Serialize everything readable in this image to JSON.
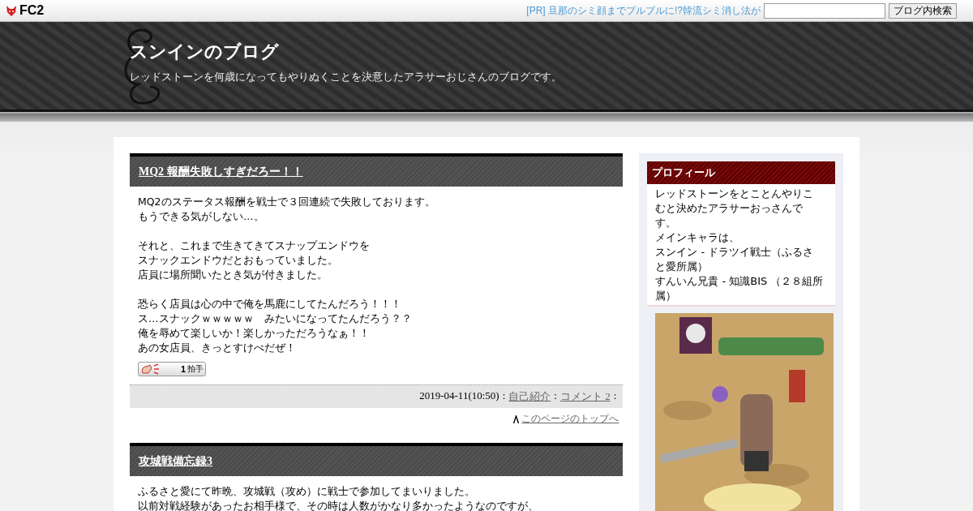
{
  "topbar": {
    "logo": "FC2",
    "ad_link": "[PR] 旦那のシミ顔までプルプルに!?韓流シミ消し法が",
    "search_button": "ブログ内検索"
  },
  "header": {
    "title": "スンインのブログ",
    "description": "レッドストーンを何歳になってもやりぬくことを決意したアラサーおじさんのブログです。"
  },
  "posts": [
    {
      "title": "MQ2 報酬失敗しすぎだろー！！",
      "paragraphs": [
        [
          "MQ2のステータス報酬を戦士で３回連続で失敗しております。",
          "もうできる気がしない…。"
        ],
        [
          "それと、これまで生きてきてスナップエンドウを",
          "スナックエンドウだとおもっていました。",
          "店員に場所聞いたとき気が付きました。"
        ],
        [
          "恐らく店員は心の中で俺を馬鹿にしてたんだろう！！！",
          "ス…スナックｗｗｗｗｗ　みたいになってたんだろう？？",
          "俺を辱めて楽しいか！楽しかっただろうなぁ！！",
          "あの女店員、きっとすけべだぜ！"
        ]
      ],
      "clap": {
        "count": "1",
        "label": "拍手"
      },
      "separators": [
        ":",
        ":",
        ":"
      ],
      "date": "2019-04-11(10:50)",
      "category": "自己紹介",
      "comments": "コメント 2",
      "top_link": "このページのトップへ"
    },
    {
      "title": "攻城戦備忘録3",
      "paragraphs": [
        [
          "ふるさと愛にて昨晩、攻城戦（攻め）に戦士で参加してまいりました。",
          "以前対戦経験があったお相手様で、その時は人数がかなり多かったようなのですが、"
        ]
      ]
    }
  ],
  "sidebar": {
    "profile": {
      "heading": "プロフィール",
      "paragraphs": [
        "レッドストーンをとことんやりこむと決めたアラサーおっさんです。",
        "メインキャラは、",
        "スンイン - ドラツイ戦士（ふるさと愛所属）",
        "すんいん兄貴 - 知識BIS （２８組所属）"
      ]
    }
  }
}
